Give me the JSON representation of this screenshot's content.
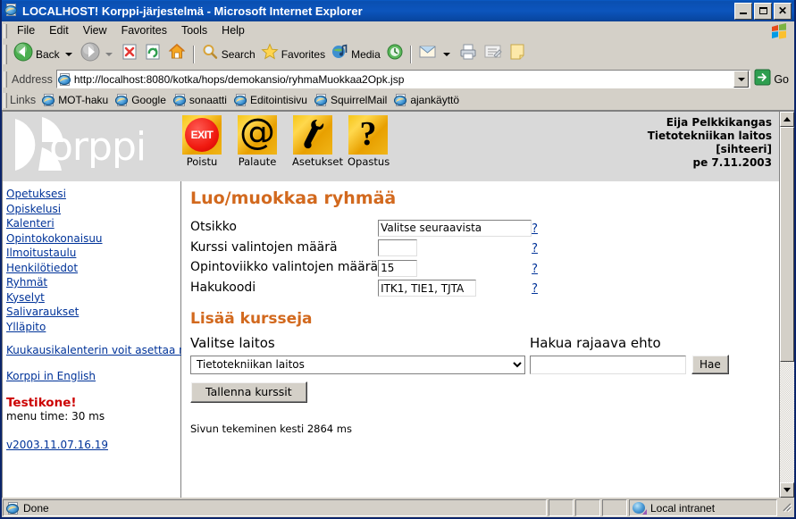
{
  "window": {
    "title": "LOCALHOST! Korppi-järjestelmä - Microsoft Internet Explorer",
    "minimize_label": "_",
    "maximize_label": "",
    "close_label": "✕",
    "app_icon": "ie-logo-icon"
  },
  "menubar": {
    "items": [
      {
        "label": "File"
      },
      {
        "label": "Edit"
      },
      {
        "label": "View"
      },
      {
        "label": "Favorites"
      },
      {
        "label": "Tools"
      },
      {
        "label": "Help"
      }
    ]
  },
  "toolbar": {
    "back_label": "Back",
    "search_label": "Search",
    "favorites_label": "Favorites",
    "media_label": "Media",
    "icons": {
      "back": "back-arrow-icon",
      "forward": "forward-arrow-icon",
      "stop": "stop-icon",
      "refresh": "refresh-icon",
      "home": "home-icon",
      "search": "magnifier-icon",
      "favorites": "star-icon",
      "media": "media-icon",
      "history": "history-icon",
      "mail": "mail-icon",
      "print": "printer-icon",
      "edit": "edit-page-icon",
      "notes": "notes-icon"
    }
  },
  "address": {
    "label": "Address",
    "url": "http://localhost:8080/kotka/hops/demokansio/ryhmaMuokkaa2Opk.jsp",
    "go_label": "Go"
  },
  "links": {
    "label": "Links",
    "items": [
      {
        "label": "MOT-haku"
      },
      {
        "label": "Google"
      },
      {
        "label": "sonaatti"
      },
      {
        "label": "Editointisivu"
      },
      {
        "label": "SquirrelMail"
      },
      {
        "label": "ajankäyttö"
      }
    ]
  },
  "page_header": {
    "logo_text": "orppi",
    "icons": [
      {
        "caption": "Poistu",
        "glyph": "EXIT",
        "name": "exit-icon"
      },
      {
        "caption": "Palaute",
        "glyph": "@",
        "name": "at-icon"
      },
      {
        "caption": "Asetukset",
        "glyph": "",
        "name": "wrench-icon"
      },
      {
        "caption": "Opastus",
        "glyph": "?",
        "name": "question-icon"
      }
    ],
    "user_name": "Eija Pelkkikangas",
    "user_dept": "Tietotekniikan laitos",
    "user_role": "[sihteeri]",
    "date": "pe 7.11.2003"
  },
  "sidebar": {
    "links": [
      {
        "label": "Opetuksesi"
      },
      {
        "label": "Opiskelusi"
      },
      {
        "label": "Kalenteri"
      },
      {
        "label": "Opintokokonaisuu"
      },
      {
        "label": "Ilmoitustaulu"
      },
      {
        "label": "Henkilötiedot"
      },
      {
        "label": "Ryhmät"
      },
      {
        "label": "Kyselyt"
      },
      {
        "label": "Salivaraukset"
      },
      {
        "label": "Ylläpito"
      }
    ],
    "note": "Kuukausikalenterin voit asettaa näkyville asetuksista.",
    "english_link": "Korppi in English",
    "test_machine": "Testikone!",
    "menu_time": "menu time: 30 ms",
    "version": "v2003.11.07.16.19"
  },
  "main": {
    "title": "Luo/muokkaa ryhmää",
    "help_marker": "?",
    "fields": [
      {
        "label": "Otsikko",
        "value": "Valitse seuraavista",
        "name": "otsikko"
      },
      {
        "label": "Kurssi valintojen määrä",
        "value": "",
        "name": "kurssi-valintojen-maara"
      },
      {
        "label": "Opintoviikko valintojen määrä",
        "value": "15",
        "name": "opintoviikko-valintojen-maara"
      },
      {
        "label": "Hakukoodi",
        "value": "ITK1, TIE1, TJTA",
        "name": "hakukoodi"
      }
    ],
    "section2_title": "Lisää kursseja",
    "select_dept_label": "Valitse laitos",
    "select_dept_value": "Tietotekniikan laitos",
    "filter_label": "Hakua rajaava ehto",
    "filter_value": "",
    "search_button": "Hae",
    "save_button": "Tallenna kurssit",
    "footer_note": "Sivun tekeminen kesti 2864 ms"
  },
  "statusbar": {
    "status_text": "Done",
    "zone_text": "Local intranet",
    "zone_icon": "globe-icon",
    "page_icon": "ie-logo-icon"
  },
  "colors": {
    "title_bar": "#0a4fb0",
    "chrome": "#d4d0c8",
    "accent_orange": "#d2691e",
    "link_blue": "#003399",
    "alert_red": "#cc0000",
    "header_band": "#d9d9d9",
    "icon_yellow": "#f0b518"
  }
}
